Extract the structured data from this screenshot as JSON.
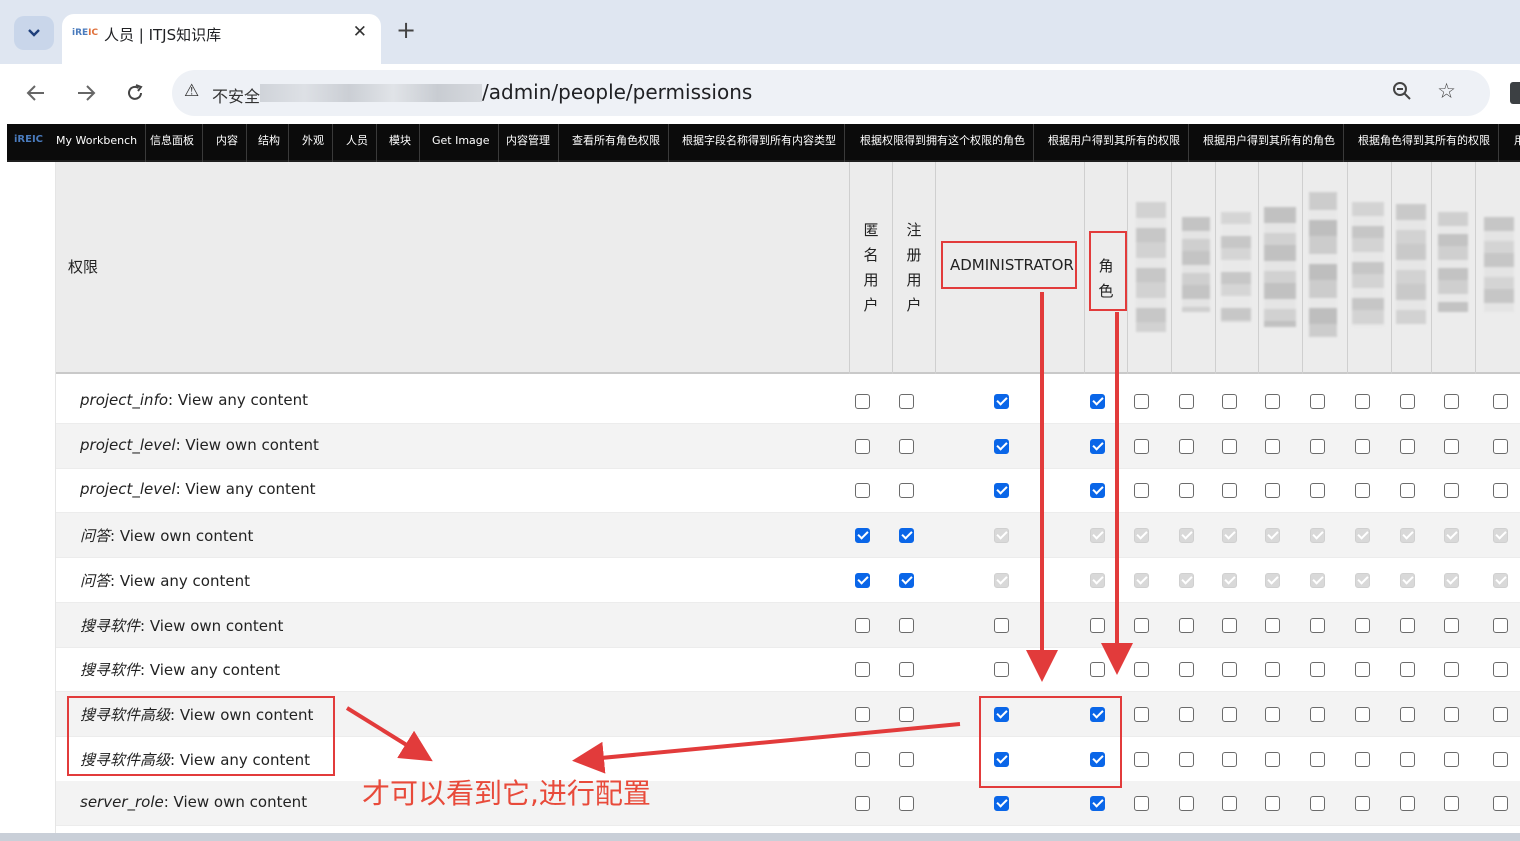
{
  "browser": {
    "tab_title": "人员 | ITJS知识库",
    "favicon_text": "iREIC",
    "close_glyph": "✕",
    "new_tab_glyph": "+",
    "security_text": "不安全",
    "url_path": "/admin/people/permissions"
  },
  "admin_menu": {
    "logo": "iREIC",
    "items": [
      "My Workbench",
      "信息面板",
      "内容",
      "结构",
      "外观",
      "人员",
      "模块",
      "Get Image",
      "内容管理",
      "查看所有角色权限",
      "根据字段名称得到所有内容类型",
      "根据权限得到拥有这个权限的角色",
      "根据用户得到其所有的权限",
      "根据用户得到其所有的角色",
      "根据角色得到其所有的权限",
      "用"
    ]
  },
  "table": {
    "perm_header": "权限",
    "col_anon": "匿名用户",
    "col_auth": "注册用户",
    "col_admin": "ADMINISTRATOR",
    "col_role": "角色",
    "rows": [
      {
        "prefix": "project_info",
        "suffix": ": View any content",
        "states": [
          "off",
          "off",
          "on",
          "on",
          "off",
          "off",
          "off",
          "off",
          "off",
          "off",
          "off",
          "off",
          "off"
        ]
      },
      {
        "prefix": "project_level",
        "suffix": ": View own content",
        "states": [
          "off",
          "off",
          "on",
          "on",
          "off",
          "off",
          "off",
          "off",
          "off",
          "off",
          "off",
          "off",
          "off"
        ]
      },
      {
        "prefix": "project_level",
        "suffix": ": View any content",
        "states": [
          "off",
          "off",
          "on",
          "on",
          "off",
          "off",
          "off",
          "off",
          "off",
          "off",
          "off",
          "off",
          "off"
        ]
      },
      {
        "prefix": "问答",
        "suffix": ": View own content",
        "states": [
          "on",
          "on",
          "dis",
          "dis",
          "dis",
          "dis",
          "dis",
          "dis",
          "dis",
          "dis",
          "dis",
          "dis",
          "dis"
        ]
      },
      {
        "prefix": "问答",
        "suffix": ": View any content",
        "states": [
          "on",
          "on",
          "dis",
          "dis",
          "dis",
          "dis",
          "dis",
          "dis",
          "dis",
          "dis",
          "dis",
          "dis",
          "dis"
        ]
      },
      {
        "prefix": "搜寻软件",
        "suffix": ": View own content",
        "states": [
          "off",
          "off",
          "off",
          "off",
          "off",
          "off",
          "off",
          "off",
          "off",
          "off",
          "off",
          "off",
          "off"
        ]
      },
      {
        "prefix": "搜寻软件",
        "suffix": ": View any content",
        "states": [
          "off",
          "off",
          "off",
          "off",
          "off",
          "off",
          "off",
          "off",
          "off",
          "off",
          "off",
          "off",
          "off"
        ]
      },
      {
        "prefix": "搜寻软件高级",
        "suffix": ": View own content",
        "states": [
          "off",
          "off",
          "on",
          "on",
          "off",
          "off",
          "off",
          "off",
          "off",
          "off",
          "off",
          "off",
          "off"
        ]
      },
      {
        "prefix": "搜寻软件高级",
        "suffix": ": View any content",
        "states": [
          "off",
          "off",
          "on",
          "on",
          "off",
          "off",
          "off",
          "off",
          "off",
          "off",
          "off",
          "off",
          "off"
        ]
      },
      {
        "prefix": "server_role",
        "suffix": ": View own content",
        "states": [
          "off",
          "off",
          "on",
          "on",
          "off",
          "off",
          "off",
          "off",
          "off",
          "off",
          "off",
          "off",
          "off"
        ]
      }
    ]
  },
  "annotation": {
    "text": "才可以看到它,进行配置",
    "color": "#e84a3a"
  },
  "colors": {
    "checkbox_checked": "#0a66e8",
    "annotation_red": "#e23b3b",
    "admin_bar": "#0b0b0b"
  }
}
